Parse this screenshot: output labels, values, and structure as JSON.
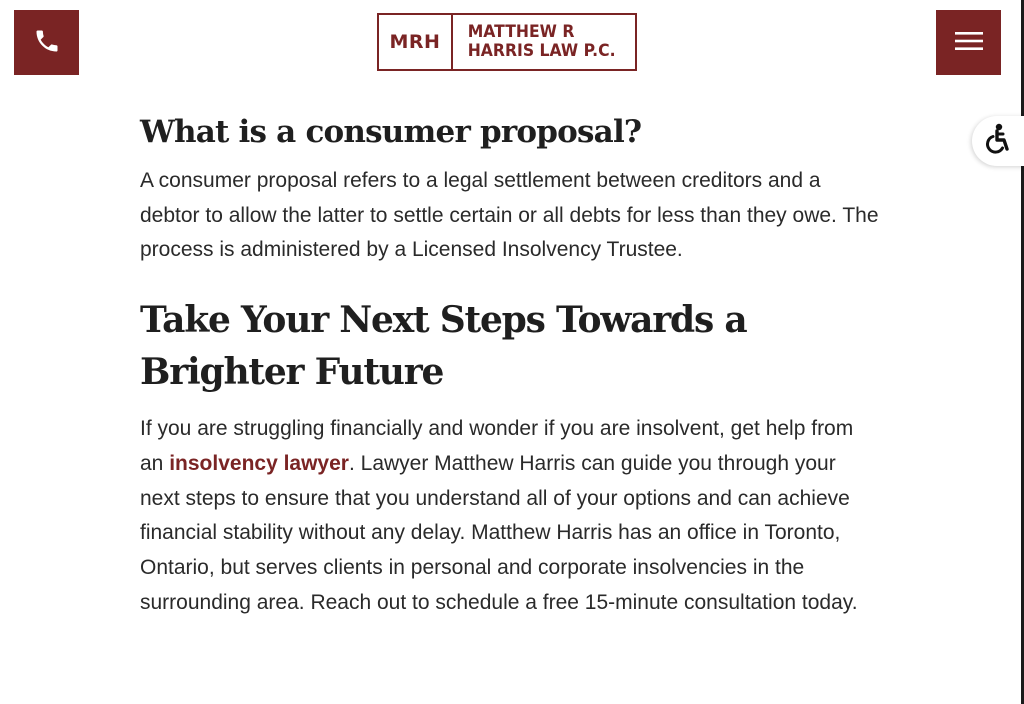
{
  "header": {
    "logo_mark": "MRH",
    "logo_name_line1": "MATTHEW R",
    "logo_name_line2": "HARRIS LAW P.C."
  },
  "icons": {
    "phone": "phone-icon",
    "menu": "hamburger-menu-icon",
    "accessibility": "accessibility-icon"
  },
  "colors": {
    "brand": "#7a2424",
    "text": "#2a2a2a",
    "heading": "#1f1f1f"
  },
  "section1": {
    "heading": "What is a consumer proposal?",
    "body": "A consumer proposal refers to a legal settlement between creditors and a debtor to allow the latter to settle certain or all debts for less than they owe. The process is administered by a Licensed Insolvency Trustee."
  },
  "section2": {
    "heading": "Take Your Next Steps Towards a Brighter Future",
    "body_before_link": "If you are struggling financially and wonder if you are insolvent, get help from an ",
    "link_text": "insolvency lawyer",
    "body_after_link": ". Lawyer Matthew Harris can guide you through your next steps to ensure that you understand all of your options and can achieve financial stability without any delay. Matthew Harris has an office in Toronto, Ontario, but serves clients in personal and corporate insolvencies in the surrounding area. Reach out to schedule a free 15-minute consultation today."
  }
}
